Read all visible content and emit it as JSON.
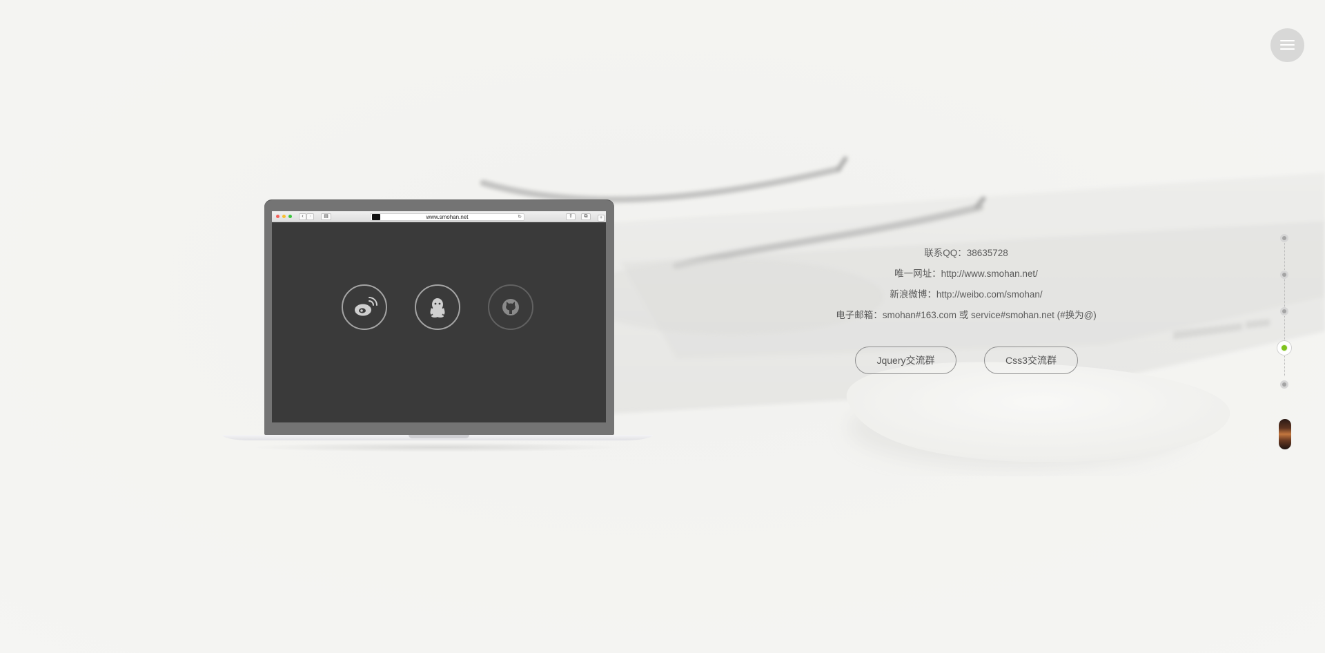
{
  "menu": {
    "icon": "hamburger-menu-icon"
  },
  "laptop": {
    "browser": {
      "url": "www.smohan.net",
      "back_glyph": "‹",
      "forward_glyph": "›",
      "sidebar_glyph": "▤",
      "reload_glyph": "↻",
      "share_glyph": "⇧",
      "tabs_glyph": "⧉",
      "plus_glyph": "+"
    },
    "social_icons": [
      "weibo-icon",
      "qq-icon",
      "github-icon"
    ]
  },
  "contact": {
    "qq": "联系QQ：38635728",
    "website": "唯一网址：http://www.smohan.net/",
    "weibo": "新浪微博：http://weibo.com/smohan/",
    "email": "电子邮箱：smohan#163.com 或 service#smohan.net (#换为@)"
  },
  "buttons": {
    "jquery": "Jquery交流群",
    "css3": "Css3交流群"
  },
  "pager": {
    "pages": 6,
    "active_index": 3,
    "active_color": "#7fc31e"
  },
  "colors": {
    "background": "#f2f2f0",
    "laptop_frame": "#747474",
    "screen": "#3a3a3a",
    "text": "#5a5a5a"
  }
}
